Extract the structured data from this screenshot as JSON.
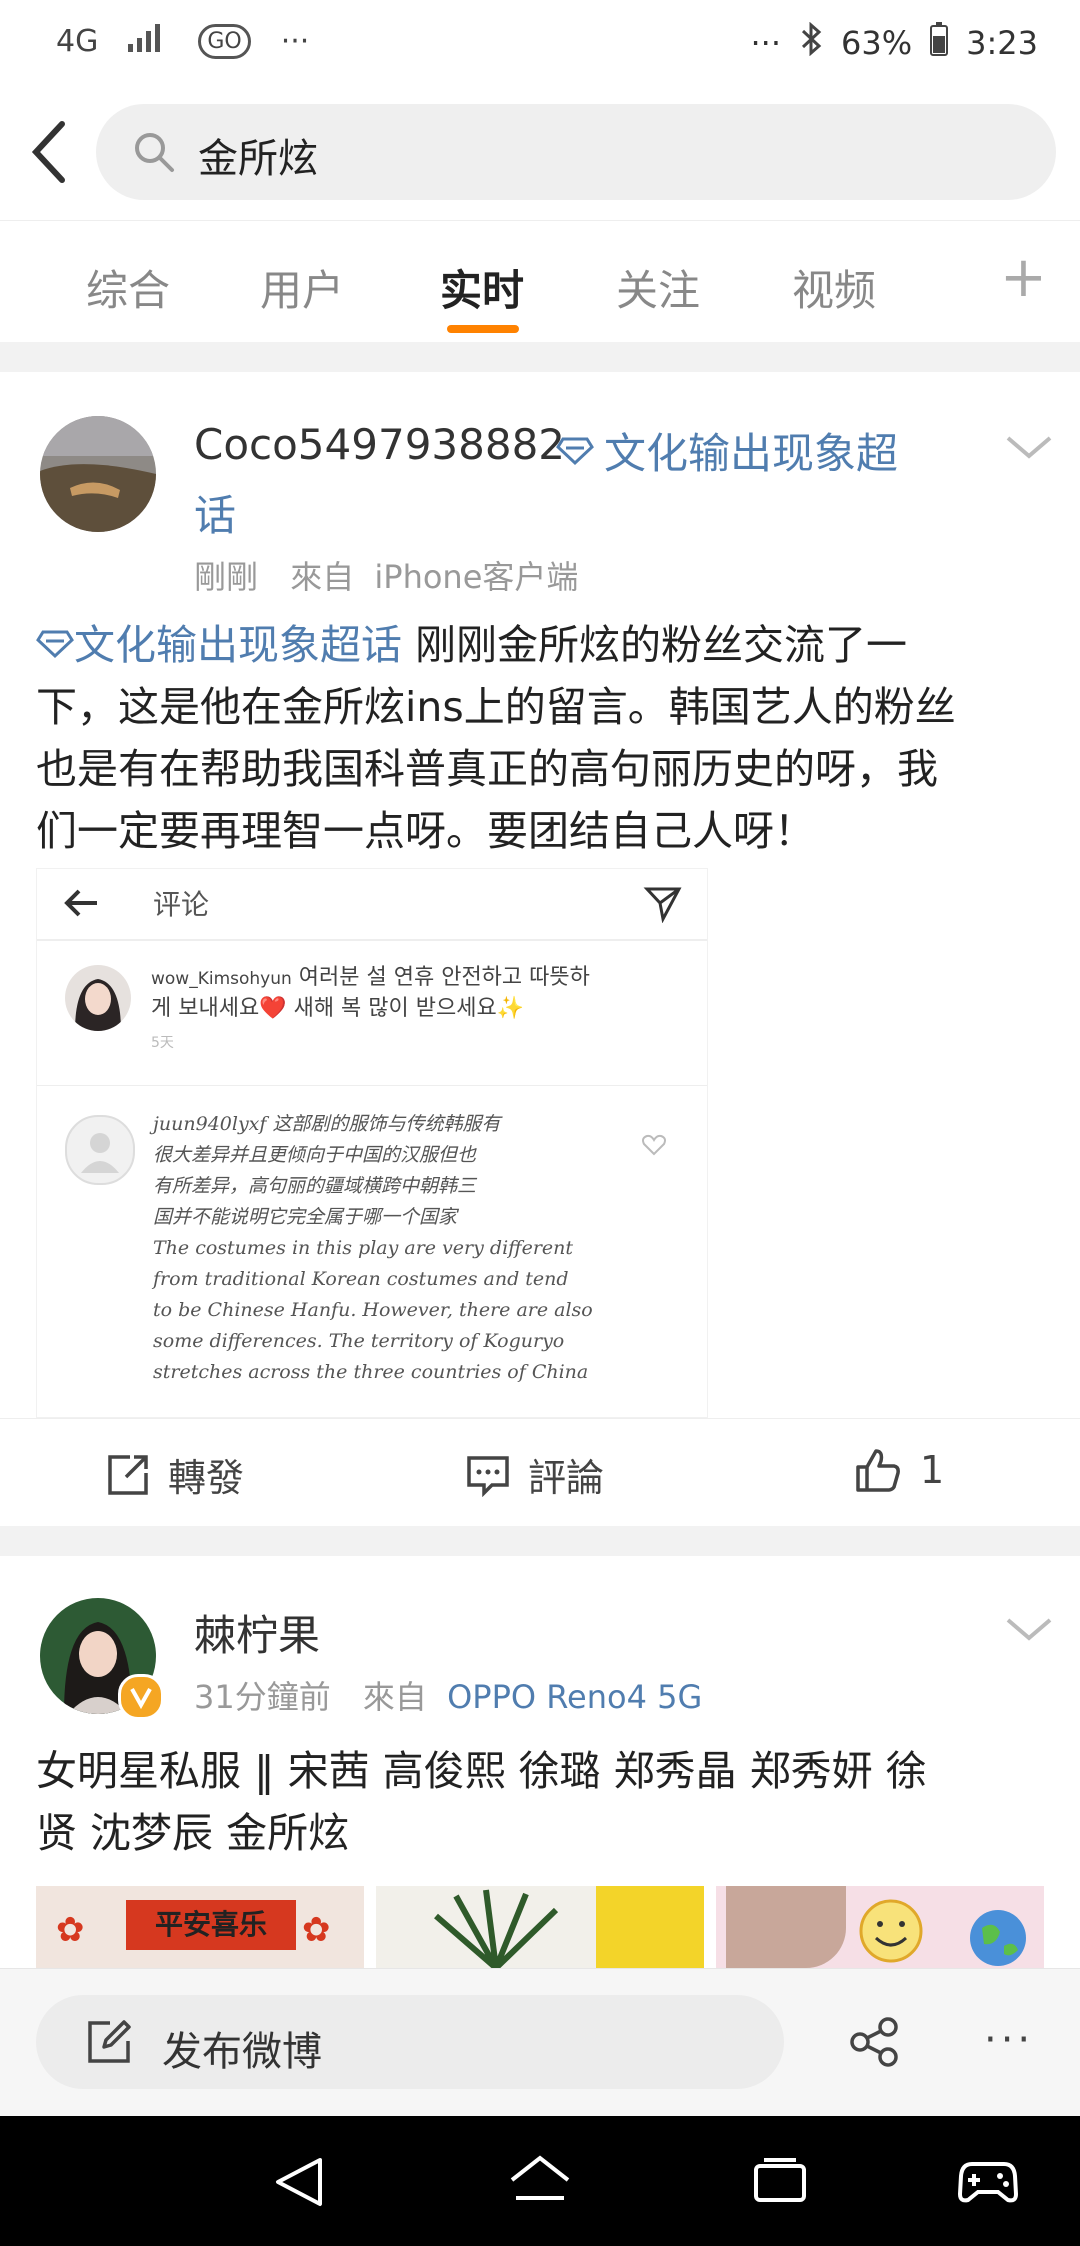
{
  "status_bar": {
    "network": "4G",
    "go_label": "GO",
    "more_left": "···",
    "more_right": "···",
    "battery": "63%",
    "time": "3:23"
  },
  "search": {
    "query": "金所炫"
  },
  "tabs": [
    {
      "label": "综合"
    },
    {
      "label": "用户"
    },
    {
      "label": "实时"
    },
    {
      "label": "关注"
    },
    {
      "label": "视频"
    }
  ],
  "post1": {
    "username": "Coco5497938882",
    "topic_line1": "文化输出现象超",
    "topic_line2": "话",
    "time": "剛剛",
    "source_prefix": "來自",
    "source": "iPhone客户端",
    "body_topic": "文化输出现象超话",
    "body_line1_rest": " 刚刚金所炫的粉丝交流了一",
    "body_line2": "下，这是他在金所炫ins上的留言。韩国艺人的粉丝",
    "body_line3": "也是有在帮助我国科普真正的高句丽历史的呀，我",
    "body_line4": "们一定要再理智一点呀。要团结自己人呀！",
    "embed": {
      "title": "评论",
      "comment1_user": "wow_Kimsohyun",
      "comment1_line1": "여러분 설 연휴 안전하고 따뜻하",
      "comment1_line2": "게 보내세요❤️ 새해 복 많이 받으세요✨",
      "comment1_time": "5天",
      "comment2_lines": [
        "juun940lyxf 这部剧的服饰与传统韩服有",
        "很大差异并且更倾向于中国的汉服但也",
        "有所差异，高句丽的疆域横跨中朝韩三",
        "国并不能说明它完全属于哪一个国家",
        "The costumes in this play are very different",
        "from traditional Korean costumes and tend",
        "to be Chinese Hanfu. However, there are also",
        "some differences. The territory of Koguryo",
        "stretches across the three countries of China"
      ]
    },
    "repost_label": "轉發",
    "comment_label": "評論",
    "like_count": "1"
  },
  "post2": {
    "username": "棘柠果",
    "time": "31分鐘前",
    "source_prefix": "來自",
    "source": "OPPO Reno4 5G",
    "body_line1": "女明星私服 ‖ 宋茜 高俊熙 徐璐 郑秀晶 郑秀妍 徐",
    "body_line2": "贤 沈梦辰 金所炫",
    "thumb1_text": "平安喜乐"
  },
  "compose": {
    "label": "发布微博"
  },
  "colors": {
    "accent": "#ff8200",
    "link": "#507daf",
    "verified": "#f5a623"
  }
}
